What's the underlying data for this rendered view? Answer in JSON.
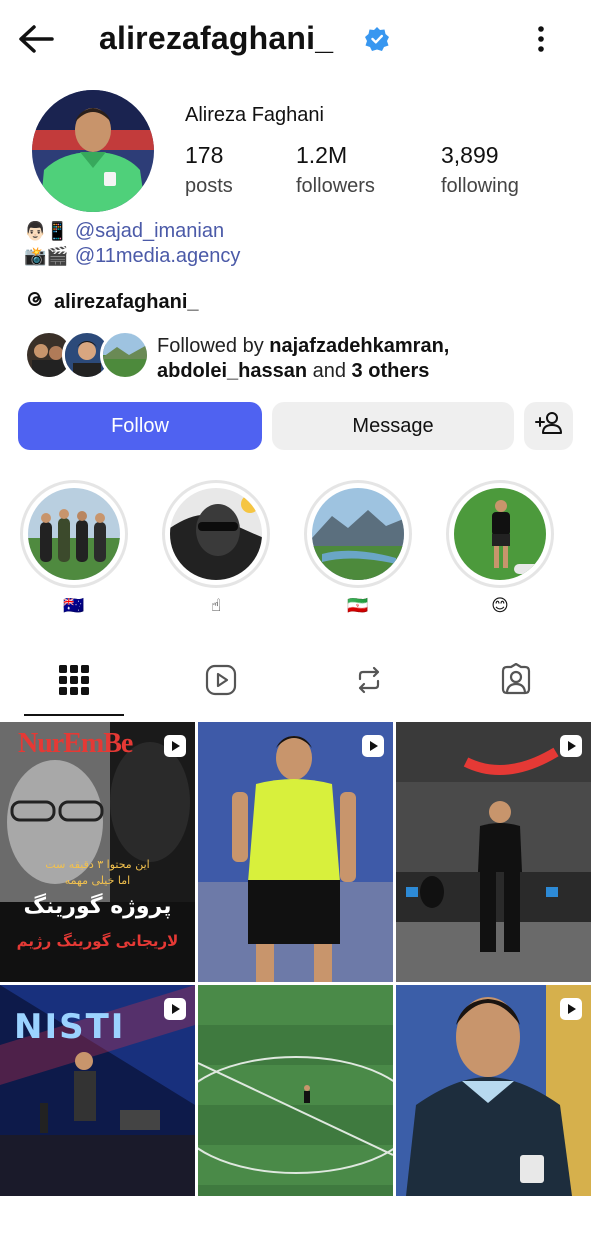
{
  "header": {
    "username": "alirezafaghani_",
    "verified": true
  },
  "profile": {
    "full_name": "Alireza Faghani",
    "stats": [
      {
        "value": "178",
        "label": "posts"
      },
      {
        "value": "1.2M",
        "label": "followers"
      },
      {
        "value": "3,899",
        "label": "following"
      }
    ],
    "bio": [
      {
        "emoji": "👨🏻📱",
        "mention": "@sajad_imanian"
      },
      {
        "emoji": "📸🎬",
        "mention": "@11media.agency"
      }
    ],
    "threads_handle": "alirezafaghani_",
    "followed_by": {
      "prefix": "Followed by ",
      "user1": "najafzadehkamran,",
      "user2": "abdolei_hassan",
      "middle": " and ",
      "others": "3 others"
    }
  },
  "actions": {
    "follow_label": "Follow",
    "message_label": "Message"
  },
  "highlights": [
    {
      "label": "🇦🇺"
    },
    {
      "label": "☝"
    },
    {
      "label": "🇮🇷"
    },
    {
      "label": "😊"
    }
  ],
  "tabs": [
    "grid-icon",
    "reels-icon",
    "reposts-icon",
    "tagged-icon"
  ],
  "posts": [
    {
      "overlay_title": "NurEmBe",
      "overlay_persian_1": "این محتوا ۳ دقیقه ست",
      "overlay_persian_2": "اما خیلی مهمه",
      "overlay_persian_3": "پروژه گورینگ",
      "overlay_persian_4": "لاریجانی گورینگ رژیم",
      "is_reel": true
    },
    {
      "is_reel": true
    },
    {
      "is_reel": true
    },
    {
      "overlay_title": "NISTI",
      "is_reel": true
    },
    {
      "is_reel": false
    },
    {
      "is_reel": true
    }
  ],
  "colors": {
    "accent": "#4f62f1",
    "verified": "#3897f0",
    "link": "#4b5aa8"
  }
}
